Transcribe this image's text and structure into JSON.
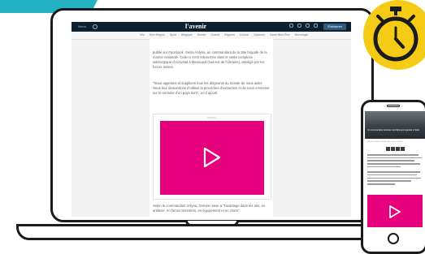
{
  "colors": {
    "accent_magenta": "#e6007e",
    "teal": "#23b3c4",
    "stopwatch_yellow": "#f5cb16",
    "header_navy": "#0b2030",
    "outline": "#1b1b1b"
  },
  "laptop": {
    "site_header": {
      "menu": "Menu",
      "logo": "l'avenir",
      "subscribe_label": "S'abonner"
    },
    "nav_items": [
      "Info",
      "Mon Région",
      "Sport",
      "Belgique",
      "Monde",
      "Gratuit",
      "Régions",
      "Culture",
      "Opinions",
      "Santé Bien-Être",
      "Nécrologie"
    ],
    "article": {
      "paragraph_1": "publié sur Facebook. Selon Volyna, un commandant de la 36e brigade de la marine nationale. Celle-ci s'est retranchée dans le vaste complexe sidérurgique d'Azovstal à Marioupol (sud-est de l'Ukraine), assiégé par les forces russes.",
      "paragraph_2": "\"Nous appelons et supplions tous les dirigeants du monde de nous aider. Nous leur demandons d'utiliser la procédure d'extraction et de nous emmener sur le territoire d'un pays tiers\", a-t-il ajouté.",
      "video_label": "Publicité",
      "paragraph_3": "Selon le commandant Volyna, l'armée russe a \"l'avantage dans les airs, en artillerie, en forces terrestres, en équipement et en chars\"."
    }
  },
  "phone": {
    "headline": "Un commandant ukrainien de Marioupol appelle à l'aide",
    "meta": "Publié le 20/04 à 10h36 – Mis à jour à 12h55"
  },
  "icons": [
    "play-icon",
    "stopwatch-icon",
    "search-icon",
    "user-icon",
    "menu-icon"
  ]
}
